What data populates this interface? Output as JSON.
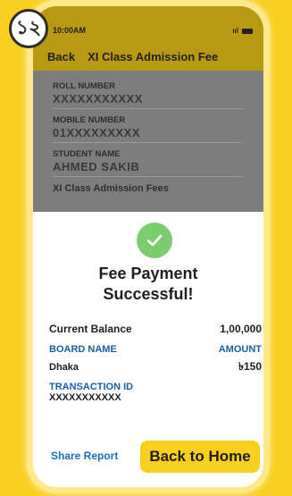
{
  "badge": {
    "step": "১২"
  },
  "status_bar": {
    "time": "10:00AM",
    "signal": "ııl"
  },
  "nav": {
    "back_label": "Back",
    "title": "XI Class Admission Fee"
  },
  "form": {
    "fields": [
      {
        "label": "ROLL NUMBER",
        "value": "XXXXXXXXXXX"
      },
      {
        "label": "MOBILE NUMBER",
        "value": "01XXXXXXXXX"
      },
      {
        "label": "STUDENT NAME",
        "value": "AHMED SAKIB"
      }
    ],
    "footer": "XI Class Admission Fees"
  },
  "result": {
    "title_line1": "Fee Payment",
    "title_line2": "Successful!",
    "balance_label": "Current Balance",
    "balance_value": "1,00,000",
    "board_label": "BOARD NAME",
    "amount_label": "AMOUNT",
    "board_value": "Dhaka",
    "amount_value": "৳150",
    "transaction_label": "TRANSACTION ID",
    "transaction_value": "XXXXXXXXXXX",
    "share_label": "Share Report",
    "home_label": "Back to Home"
  },
  "colors": {
    "background": "#f9cf1f",
    "header": "#b89a12",
    "success": "#7ccc70",
    "link": "#1a5fa8",
    "button": "#f9cf1f"
  }
}
